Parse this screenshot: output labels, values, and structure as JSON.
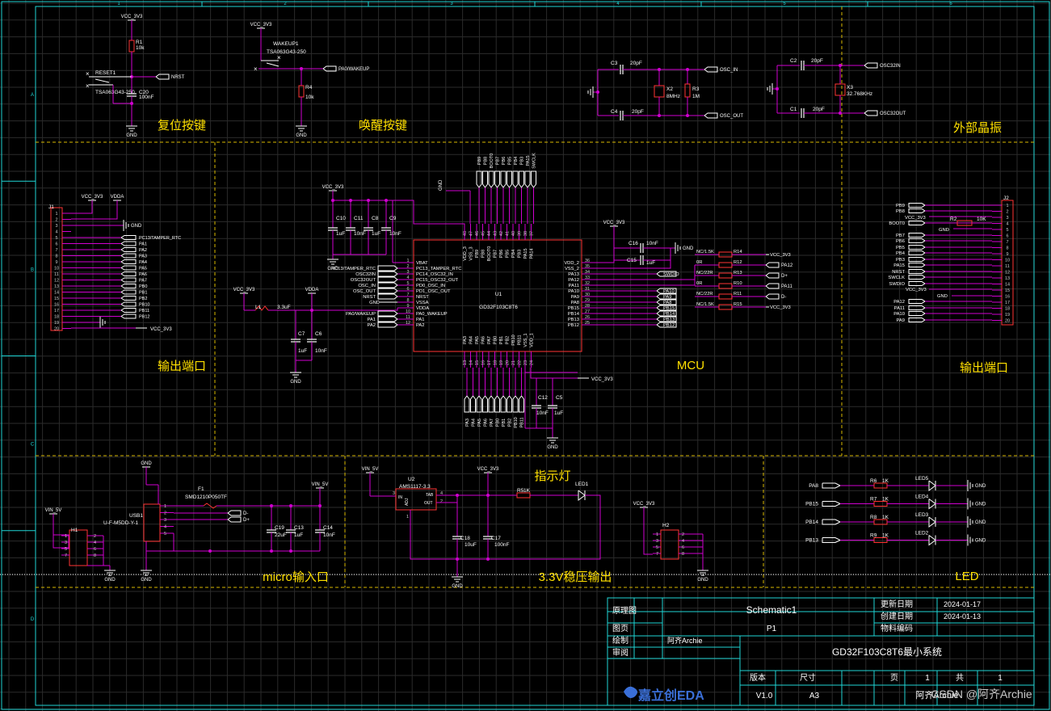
{
  "colors": {
    "background": "#000000",
    "grid": "#2b2b2b",
    "frame": "#1fd5d5",
    "wire": "#d000d0",
    "component": "#ff3333",
    "text": "#ffffff",
    "net_label": "#d0d0d0",
    "pin_number": "#cccccc",
    "section_label": "#ffe000",
    "divider": "#d8b800",
    "logo": "#3a6fd8"
  },
  "frame": {
    "col_markers": [
      "1",
      "2",
      "3",
      "4",
      "5",
      "6"
    ],
    "row_markers": [
      "A",
      "B",
      "C",
      "D"
    ]
  },
  "sections": {
    "reset": "复位按键",
    "wakeup": "唤醒按键",
    "crystal": "外部晶振",
    "output_left": "输出端口",
    "mcu": "MCU",
    "output_right": "输出端口",
    "indicator": "指示灯",
    "micro": "micro输入口",
    "ldo": "3.3V稳压输出",
    "led": "LED"
  },
  "reset": {
    "vcc": "VCC_3V3",
    "r1": "R1",
    "r1_val": "10k",
    "sw": "RESET1",
    "sw_part": "TSA063G43-250",
    "c20": "C20",
    "c20_val": "100nF",
    "net": "NRST",
    "gnd": "GND"
  },
  "wakeup": {
    "vcc": "VCC_3V3",
    "sw": "WAKEUP1",
    "sw_part": "TSA063G43-250",
    "net": "PA0/WAKEUP",
    "r4": "R4",
    "r4_val": "10k",
    "gnd": "GND"
  },
  "crystal": {
    "c3": "C3",
    "c3_val": "20pF",
    "c4": "C4",
    "c4_val": "20pF",
    "x2": "X2",
    "x2_val": "8MHz",
    "r3": "R3",
    "r3_val": "1M",
    "osc_in": "OSC_IN",
    "osc_out": "OSC_OUT",
    "c2": "C2",
    "c2_val": "20pF",
    "c1": "C1",
    "c1_val": "20pF",
    "x3": "X3",
    "x3_val": "32.768KHz",
    "osc32in": "OSC32IN",
    "osc32out": "OSC32OUT"
  },
  "j1": {
    "ref": "J1",
    "vcc": "VCC_3V3",
    "vdda": "VDDA",
    "gnd": "GND",
    "bottom_vcc": "VCC_3V3",
    "pins": [
      "1",
      "2",
      "3",
      "4",
      "5",
      "6",
      "7",
      "8",
      "9",
      "10",
      "11",
      "12",
      "13",
      "14",
      "15",
      "16",
      "17",
      "18",
      "19",
      "20"
    ],
    "nets": [
      "PC13/TAMPER_RTC",
      "PA1",
      "PA2",
      "PA3",
      "PA4",
      "PA5",
      "PA6",
      "PA7",
      "PB0",
      "PB1",
      "PB2",
      "PB10",
      "PB11",
      "PB12"
    ]
  },
  "mcu": {
    "ref": "U1",
    "part": "GD32F103C8T6",
    "left_pins": [
      {
        "num": "1",
        "name": "VBAT",
        "net": ""
      },
      {
        "num": "2",
        "name": "PC13_TAMPER_RTC",
        "net": "PC13/TAMPER_RTC"
      },
      {
        "num": "3",
        "name": "PC14_OSC32_IN",
        "net": "OSC32IN"
      },
      {
        "num": "4",
        "name": "PC15_OSC32_OUT",
        "net": "OSC32OUT"
      },
      {
        "num": "5",
        "name": "PD0_OSC_IN",
        "net": "OSC_IN"
      },
      {
        "num": "6",
        "name": "PD1_OSC_OUT",
        "net": "OSC_OUT"
      },
      {
        "num": "7",
        "name": "NRST",
        "net": "NRST"
      },
      {
        "num": "8",
        "name": "VSSA",
        "net": "GND"
      },
      {
        "num": "9",
        "name": "VDDA",
        "net": ""
      },
      {
        "num": "10",
        "name": "PA0_WAKEUP",
        "net": "PA0/WAKEUP"
      },
      {
        "num": "11",
        "name": "PA1",
        "net": "PA1"
      },
      {
        "num": "12",
        "name": "PA2",
        "net": "PA2"
      }
    ],
    "right_pins": [
      {
        "num": "36",
        "name": "VDD_2",
        "net": ""
      },
      {
        "num": "35",
        "name": "VSS_2",
        "net": ""
      },
      {
        "num": "34",
        "name": "PA13",
        "net": "SWDIO"
      },
      {
        "num": "33",
        "name": "PA12",
        "net": ""
      },
      {
        "num": "32",
        "name": "PA11",
        "net": ""
      },
      {
        "num": "31",
        "name": "PA10",
        "net": "PA10"
      },
      {
        "num": "30",
        "name": "PA9",
        "net": "PA9"
      },
      {
        "num": "29",
        "name": "PA8",
        "net": "PA8"
      },
      {
        "num": "28",
        "name": "PB15",
        "net": "PB15"
      },
      {
        "num": "27",
        "name": "PB14",
        "net": "PB14"
      },
      {
        "num": "26",
        "name": "PB13",
        "net": "PB13"
      },
      {
        "num": "25",
        "name": "PB12",
        "net": "PB12"
      }
    ],
    "top_pins": [
      {
        "num": "48",
        "name": "VDD_3"
      },
      {
        "num": "47",
        "name": "VSS_3"
      },
      {
        "num": "46",
        "name": "PB9"
      },
      {
        "num": "45",
        "name": "PB8"
      },
      {
        "num": "44",
        "name": "BOOT0"
      },
      {
        "num": "43",
        "name": "PB7"
      },
      {
        "num": "42",
        "name": "PB6"
      },
      {
        "num": "41",
        "name": "PB5"
      },
      {
        "num": "40",
        "name": "PB4"
      },
      {
        "num": "39",
        "name": "PB3"
      },
      {
        "num": "38",
        "name": "PA15"
      },
      {
        "num": "37",
        "name": "PA14"
      }
    ],
    "top_nets": [
      "PB9",
      "PB8",
      "BOOT0",
      "PB7",
      "PB6",
      "PB5",
      "PB4",
      "PB3",
      "PA15",
      "SWCLK"
    ],
    "bottom_pins": [
      {
        "num": "13",
        "name": "PA3"
      },
      {
        "num": "14",
        "name": "PA4"
      },
      {
        "num": "15",
        "name": "PA5"
      },
      {
        "num": "16",
        "name": "PA6"
      },
      {
        "num": "17",
        "name": "PA7"
      },
      {
        "num": "18",
        "name": "PB0"
      },
      {
        "num": "19",
        "name": "PB1"
      },
      {
        "num": "20",
        "name": "PB2"
      },
      {
        "num": "21",
        "name": "PB10"
      },
      {
        "num": "22",
        "name": "PB11"
      },
      {
        "num": "23",
        "name": "VSS_1"
      },
      {
        "num": "24",
        "name": "VDD_1"
      }
    ],
    "bottom_nets": [
      "PA3",
      "PA4",
      "PA5",
      "PA6",
      "PA7",
      "PB0",
      "PB1",
      "PB2",
      "PB10",
      "PB11"
    ]
  },
  "mcu_top_caps": {
    "vcc": "VCC_3V3",
    "gnd_top": "GND",
    "gnd": "GND",
    "caps": [
      {
        "ref": "C10",
        "val": "1uF"
      },
      {
        "ref": "C11",
        "val": "10nF"
      },
      {
        "ref": "C8",
        "val": "1uF"
      },
      {
        "ref": "C9",
        "val": "10nF"
      }
    ]
  },
  "vdda_filter": {
    "vcc": "VCC_3V3",
    "l1": "L1",
    "l1_val": "3.3uF",
    "vdda": "VDDA",
    "c7": "C7",
    "c7_val": "1uF",
    "c6": "C6",
    "c6_val": "10nF",
    "gnd": "GND"
  },
  "mcu_right_caps": {
    "vcc": "VCC_3V3",
    "c16": "C16",
    "c16_val": "10nF",
    "c15": "C15",
    "c15_val": "1uF",
    "gnd": "GND"
  },
  "mcu_right_res": [
    {
      "ref": "R14",
      "val": "NC/1.5K",
      "net": "VCC_3V3"
    },
    {
      "ref": "R12",
      "val": "0R",
      "net": "PA12"
    },
    {
      "ref": "R13",
      "val": "NC/22R",
      "net": "D+"
    },
    {
      "ref": "R10",
      "val": "0R",
      "net": "PA11"
    },
    {
      "ref": "R11",
      "val": "NC/22R",
      "net": "D-"
    },
    {
      "ref": "R15",
      "val": "NC/1.5K",
      "net": "VCC_3V3"
    }
  ],
  "mcu_bottom_caps": {
    "c12": "C12",
    "c12_val": "10nF",
    "c5": "C5",
    "c5_val": "1uF",
    "vcc": "VCC_3V3",
    "gnd": "GND"
  },
  "j2": {
    "ref": "J2",
    "vcc": "VCC_3V3",
    "r2": "R2",
    "r2_val": "10K",
    "gnd": "GND",
    "pins": [
      "1",
      "2",
      "3",
      "4",
      "5",
      "6",
      "7",
      "8",
      "9",
      "10",
      "11",
      "12",
      "13",
      "14",
      "15",
      "16",
      "17",
      "18",
      "19",
      "20"
    ],
    "nets": [
      "PB9",
      "PB8",
      "BOOT0",
      "PB7",
      "PB6",
      "PB5",
      "PB4",
      "PB3",
      "PA15",
      "NRST",
      "SWCLK",
      "SWDIO",
      "PA12",
      "PA11",
      "PA10",
      "PA9"
    ]
  },
  "micro": {
    "vin": "VIN_5V",
    "h1": "H1",
    "usb": "USB1",
    "usb_part": "U-F-M5DD-Y-1",
    "gnd": "GND",
    "f1": "F1",
    "f1_part": "SMD1210P050TF",
    "dm": "D-",
    "dp": "D+",
    "vin2": "VIN_5V",
    "c19": "C19",
    "c19_val": "22uF",
    "c13": "C13",
    "c13_val": "1uF",
    "c14": "C14",
    "c14_val": "10nF"
  },
  "ldo": {
    "vin": "VIN_5V",
    "u2": "U2",
    "u2_part": "AMS1117-3.3",
    "pin_in": "IN",
    "pin_tab": "TAB",
    "pin_out": "OUT",
    "pin_adj": "ADJ",
    "vcc": "VCC_3V3",
    "c18": "C18",
    "c18_val": "10uF",
    "c17": "C17",
    "c17_val": "100nF",
    "gnd": "GND",
    "r5": "R5",
    "r5_val": "1K",
    "led1": "LED1"
  },
  "h2": {
    "vcc": "VCC_3V3",
    "ref": "H2",
    "gnd": "GND"
  },
  "leds": [
    {
      "net": "PA8",
      "r": "R6",
      "rv": "1K",
      "led": "LED5",
      "gnd": "GND"
    },
    {
      "net": "PB15",
      "r": "R7",
      "rv": "1K",
      "led": "LED4",
      "gnd": "GND"
    },
    {
      "net": "PB14",
      "r": "R8",
      "rv": "1K",
      "led": "LED3",
      "gnd": "GND"
    },
    {
      "net": "PB13",
      "r": "R9",
      "rv": "1K",
      "led": "LED2",
      "gnd": "GND"
    }
  ],
  "title_block": {
    "label_schematic": "原理图",
    "schematic_name": "Schematic1",
    "label_update": "更新日期",
    "update_date": "2024-01-17",
    "label_created": "创建日期",
    "created_date": "2024-01-13",
    "label_page": "图页",
    "page": "P1",
    "label_material": "物料编码",
    "label_drawn": "绘制",
    "drawn_by": "阿齐Archie",
    "label_review": "审阅",
    "project_title": "GD32F103C8T6最小系统",
    "label_version": "版本",
    "label_size": "尺寸",
    "label_pageno": "页",
    "page_no": "1",
    "label_total": "共",
    "total": "1",
    "version": "V1.0",
    "size": "A3",
    "logo": "嘉立创EDA",
    "author_overlay": "阿齐Archie",
    "watermark": "CSDN @阿齐Archie"
  }
}
